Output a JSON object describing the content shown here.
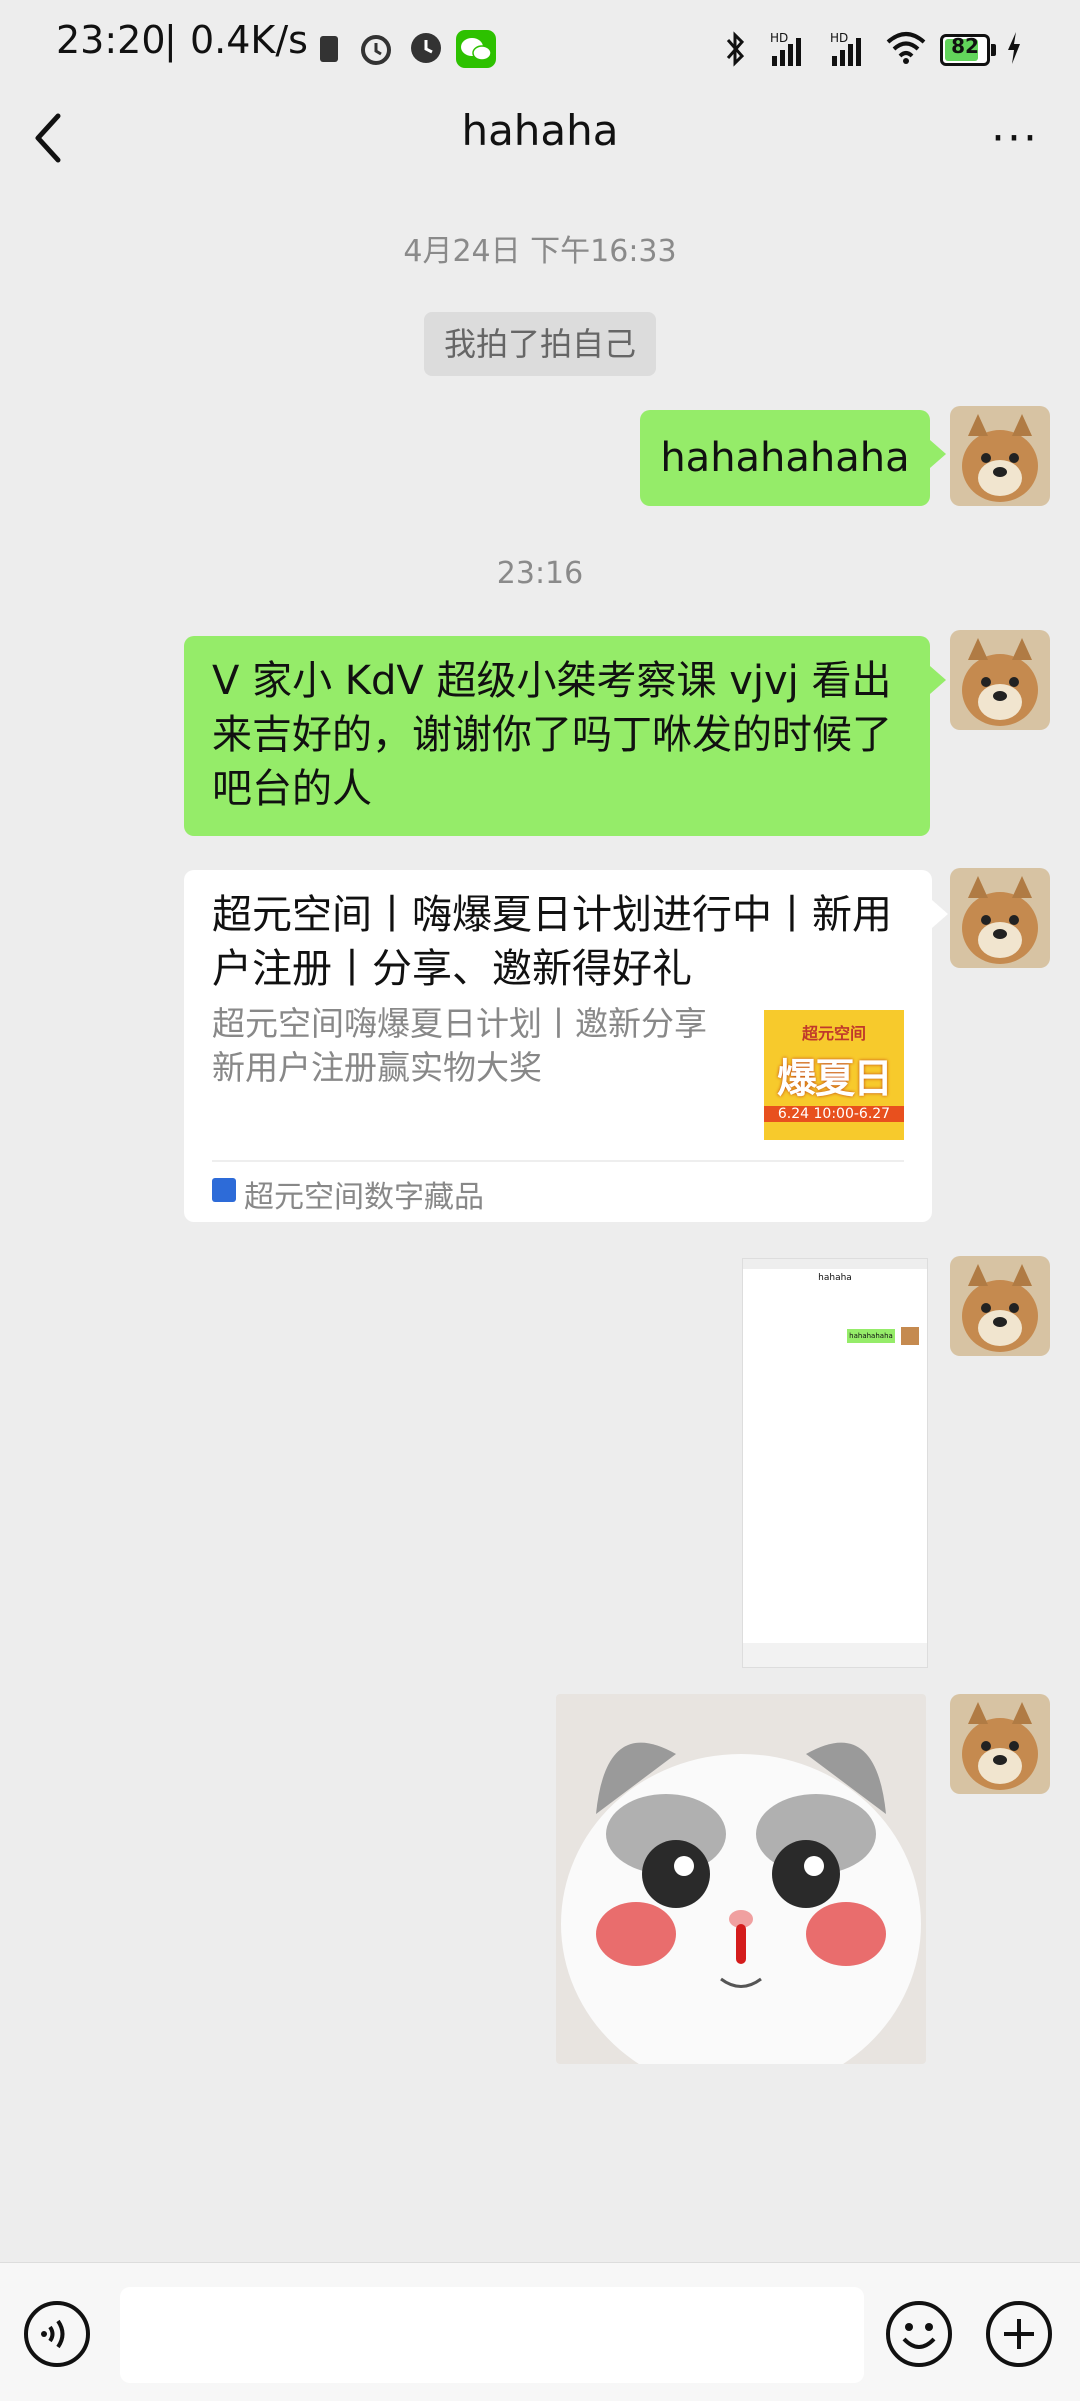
{
  "status_bar": {
    "time": "23:20",
    "separator": "|",
    "net_speed": "0.4K/s",
    "battery": "82",
    "icons": [
      "sim-icon",
      "alarm-icon",
      "clock-icon",
      "wechat-icon",
      "bluetooth-icon",
      "signal-hd-icon",
      "signal-hd2-icon",
      "wifi-icon",
      "battery-icon",
      "charging-icon"
    ]
  },
  "nav": {
    "title": "hahaha",
    "back_icon": "chevron-left-icon",
    "more_label": "···"
  },
  "chat": {
    "timestamp1": "4月24日 下午16:33",
    "system_msg": "我拍了拍自己",
    "msg1": "hahahahaha",
    "timestamp2": "23:16",
    "msg2": "V 家小 KdV 超级小桀考察课 vjvj 看出来吉好的，谢谢你了吗丁咻发的时候了吧台的人",
    "card": {
      "title": "超元空间丨嗨爆夏日计划进行中丨新用户注册丨分享、邀新得好礼",
      "description": "超元空间嗨爆夏日计划丨邀新分享新用户注册赢实物大奖",
      "thumb_brand": "超元空间",
      "thumb_text": "爆夏日",
      "thumb_date": "6.24 10:00-6.27",
      "source": "超元空间数字藏品"
    },
    "screenshot_thumb": {
      "title": "hahaha",
      "bubble": "hahahahaha"
    }
  },
  "input_bar": {
    "voice_icon": "voice-icon",
    "emoji_icon": "emoji-icon",
    "plus_icon": "plus-icon",
    "placeholder": ""
  },
  "colors": {
    "my_bubble": "#95EC69",
    "background": "#EDEDED",
    "card_thumb": "#F7CA2C"
  }
}
